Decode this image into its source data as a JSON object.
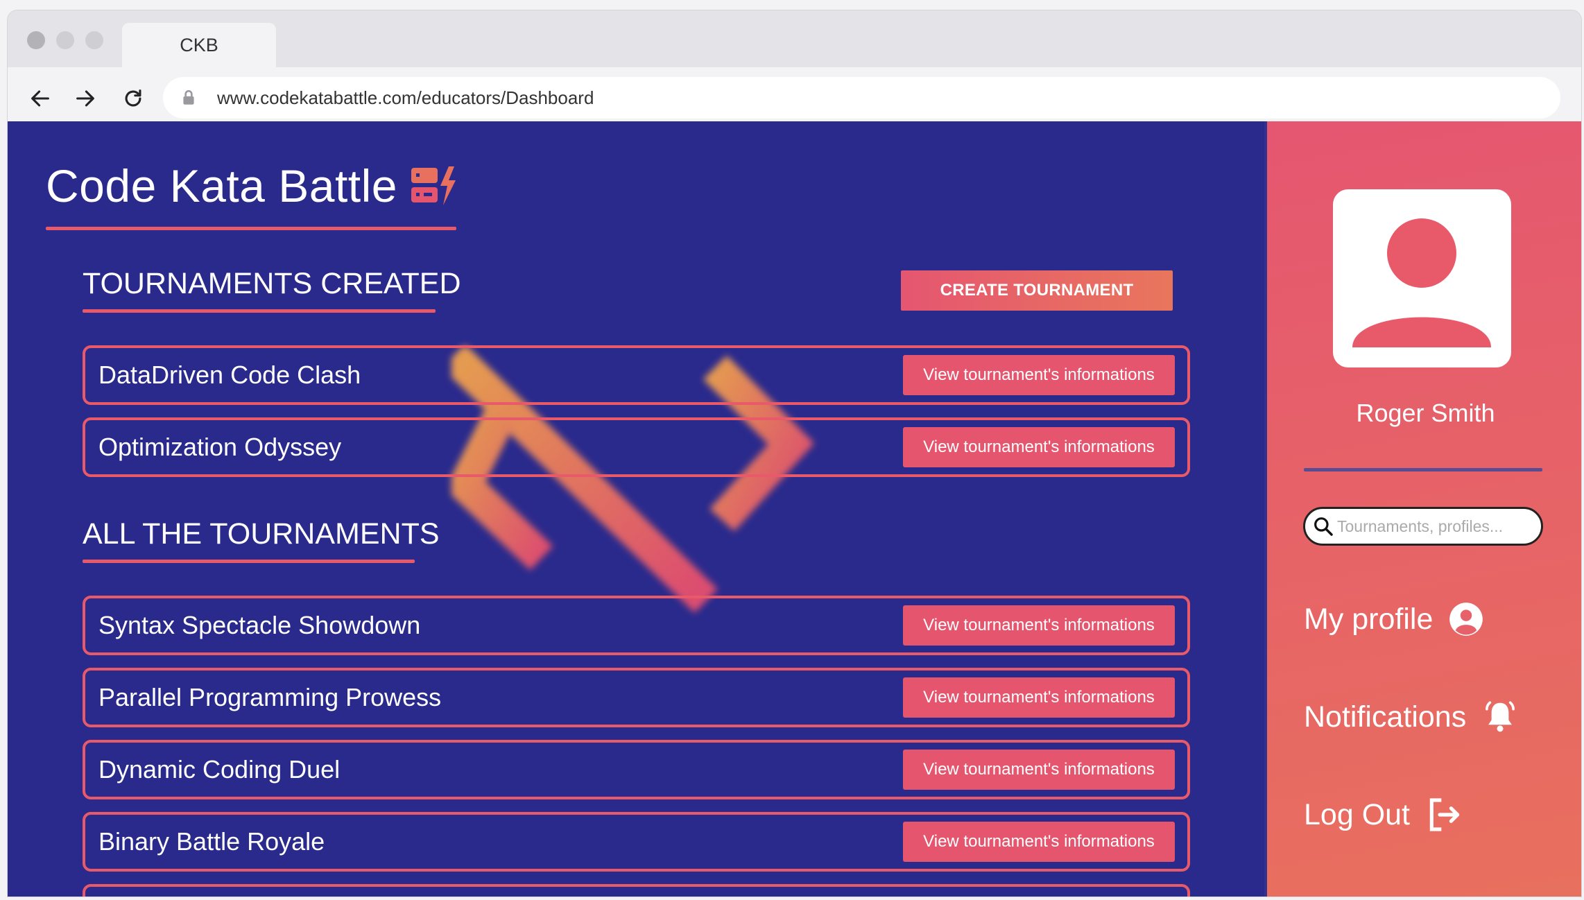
{
  "browser": {
    "tab_title": "CKB",
    "url": "www.codekatabattle.com/educators/Dashboard"
  },
  "brand": {
    "title": "Code Kata Battle"
  },
  "colors": {
    "accent": "#e85a6a",
    "background": "#2a2a8c",
    "sidebar_start": "#e55670",
    "sidebar_end": "#e8705e"
  },
  "created_section": {
    "title": "TOURNAMENTS CREATED",
    "create_button": "CREATE TOURNAMENT",
    "items": [
      {
        "name": "DataDriven Code Clash",
        "action": "View tournament's informations"
      },
      {
        "name": "Optimization Odyssey",
        "action": "View tournament's informations"
      }
    ]
  },
  "all_section": {
    "title": "ALL THE TOURNAMENTS",
    "items": [
      {
        "name": "Syntax Spectacle Showdown",
        "action": "View tournament's informations"
      },
      {
        "name": "Parallel Programming Prowess",
        "action": "View tournament's informations"
      },
      {
        "name": "Dynamic Coding Duel",
        "action": "View tournament's informations"
      },
      {
        "name": "Binary Battle Royale",
        "action": "View tournament's informations"
      }
    ]
  },
  "sidebar": {
    "user_name": "Roger Smith",
    "search_placeholder": "Tournaments, profiles...",
    "my_profile": "My profile",
    "notifications": "Notifications",
    "log_out": "Log Out"
  }
}
